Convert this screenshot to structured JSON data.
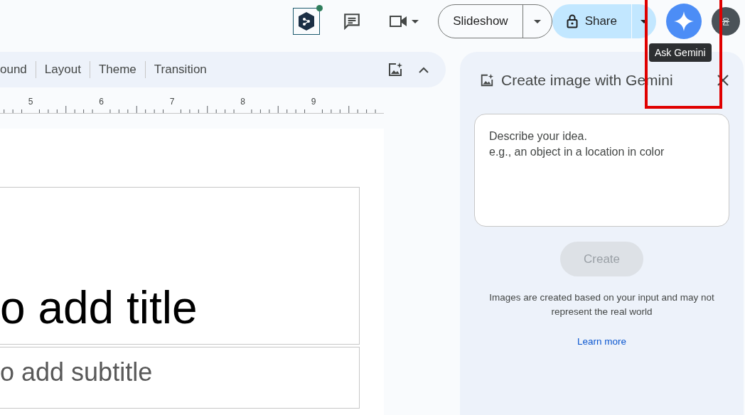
{
  "top_bar": {
    "slideshow_button": "Slideshow",
    "share_button": "Share",
    "avatar_initial": "윤",
    "tooltip": "Ask Gemini"
  },
  "toolbar": {
    "items": [
      "ound",
      "Layout",
      "Theme",
      "Transition"
    ]
  },
  "ruler": {
    "marks": [
      "5",
      "6",
      "7",
      "8",
      "9"
    ]
  },
  "slide": {
    "title_placeholder": "o add title",
    "subtitle_placeholder": "o add subtitle"
  },
  "panel": {
    "title": "Create image with Gemini",
    "prompt_placeholder": "Describe your idea.\ne.g., an object in a location in color",
    "create_button": {
      "label": "Create",
      "disabled": true
    },
    "disclaimer": "Images are created based on your input and may not represent the real world",
    "learn_more": "Learn more"
  }
}
